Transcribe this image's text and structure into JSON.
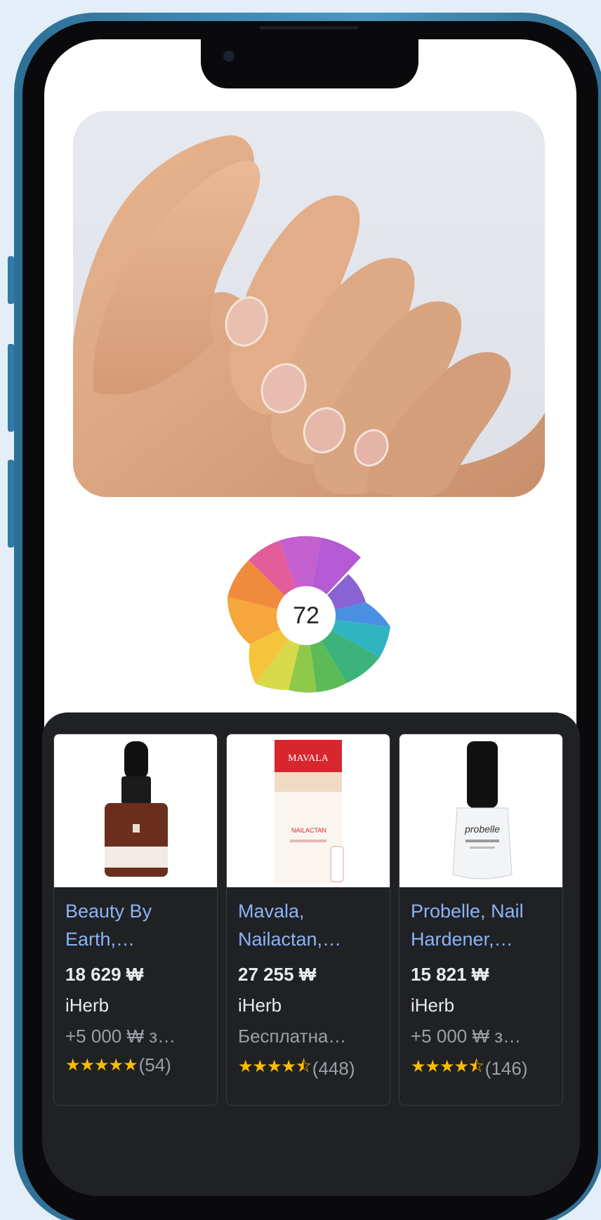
{
  "product_wheel": {
    "score": "72"
  },
  "products": [
    {
      "title": "Beauty By Earth,…",
      "price": "18 629 ₩",
      "store": "iHerb",
      "shipping": "+5 000 ₩ з…",
      "stars": "★★★★★",
      "reviews": "(54)",
      "rating": 5
    },
    {
      "title": "Mavala, Nailactan,…",
      "price": "27 255 ₩",
      "store": "iHerb",
      "shipping": "Бесплатна…",
      "stars": "★★★★⯪",
      "reviews": "(448)",
      "rating": 4.5,
      "image_text": {
        "brand": "MAVALA",
        "product": "NAILACTAN"
      }
    },
    {
      "title": "Probelle, Nail Hardener,…",
      "price": "15 821 ₩",
      "store": "iHerb",
      "shipping": "+5 000 ₩ з…",
      "stars": "★★★★⯪",
      "reviews": "(146)",
      "rating": 4.5,
      "image_text": {
        "brand": "probelle"
      }
    }
  ],
  "colors": {
    "frame": "#3d86b1",
    "panel_bg": "#202124",
    "link": "#8ab4f8",
    "star": "#fbbc04"
  }
}
